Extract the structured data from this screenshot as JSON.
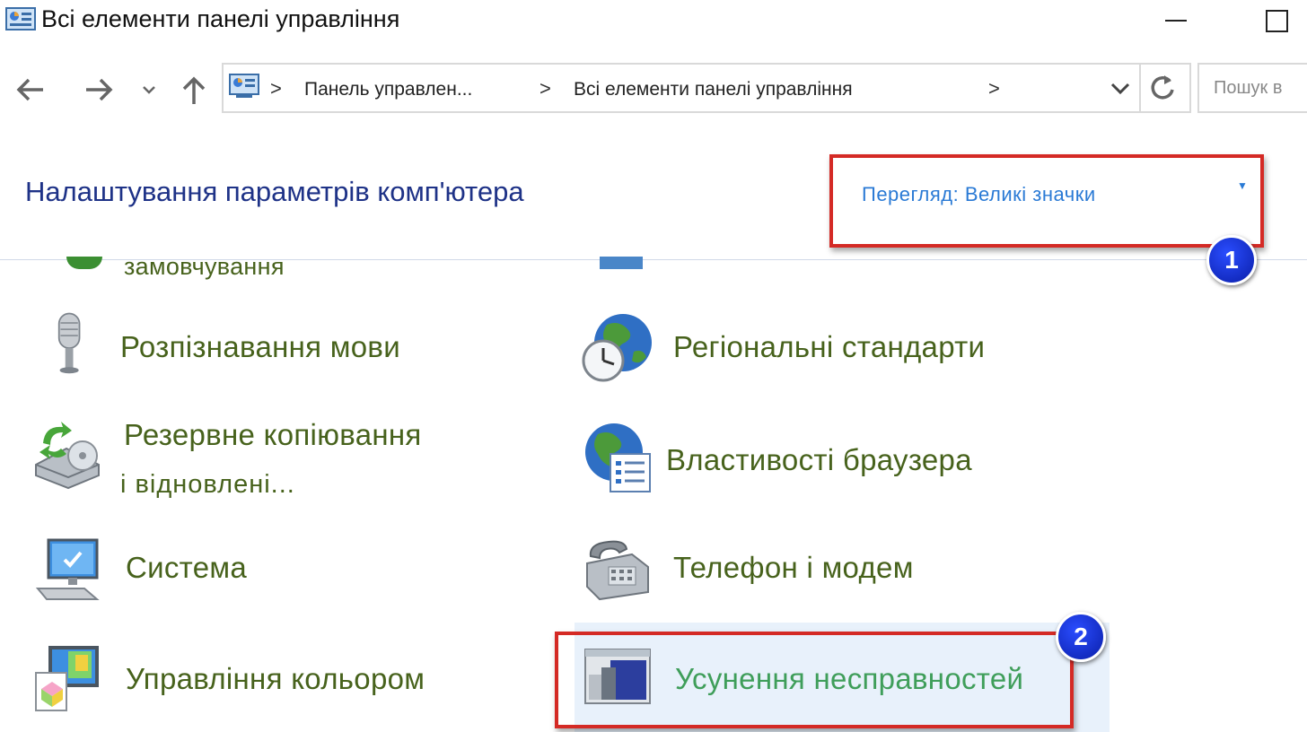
{
  "window": {
    "title": "Всі елементи панелі управління"
  },
  "nav": {
    "back_icon": "back-arrow-icon",
    "forward_icon": "forward-arrow-icon",
    "recent_icon": "chevron-down-icon",
    "up_icon": "up-arrow-icon"
  },
  "address_bar": {
    "separator": ">",
    "crumbs": [
      "Панель управлен...",
      "Всі елементи панелі управління"
    ]
  },
  "search": {
    "placeholder": "Пошук в"
  },
  "header": {
    "title": "Налаштування параметрів комп'ютера",
    "view_label": "Перегляд: Великі значки"
  },
  "annotations": {
    "badge_1": "1",
    "badge_2": "2"
  },
  "items": {
    "default_programs": "замовчування",
    "speech_recognition": "Розпізнавання мови",
    "region": "Регіональні стандарти",
    "backup_line1": "Резервне копіювання",
    "backup_line2": "і відновлені...",
    "internet_options": "Властивості браузера",
    "system": "Система",
    "phone_modem": "Телефон і модем",
    "color_management": "Управління кольором",
    "troubleshooting": "Усунення несправностей"
  },
  "colors": {
    "accent_red": "#d42a25",
    "badge_blue": "#0a1ea8",
    "item_text": "#47621c",
    "title_text": "#1e3287",
    "link_blue": "#2a7ad5"
  }
}
